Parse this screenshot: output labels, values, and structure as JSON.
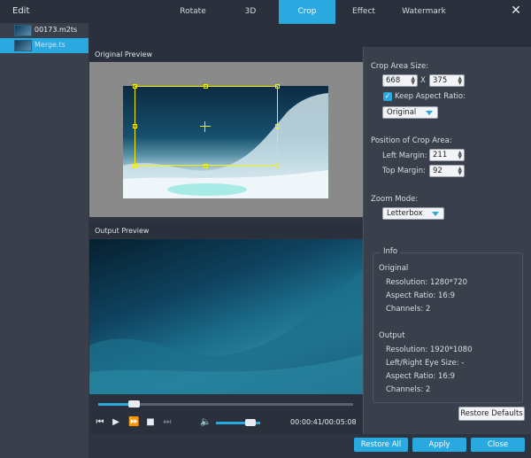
{
  "window": {
    "title": "Edit",
    "close_icon": "close-icon"
  },
  "files": [
    {
      "name": "00173.m2ts",
      "selected": false
    },
    {
      "name": "Merge.ts",
      "selected": true
    }
  ],
  "tabs": [
    {
      "label": "Rotate",
      "active": false
    },
    {
      "label": "3D",
      "active": false
    },
    {
      "label": "Crop",
      "active": true
    },
    {
      "label": "Effect",
      "active": false
    },
    {
      "label": "Watermark",
      "active": false
    }
  ],
  "preview": {
    "original_label": "Original Preview",
    "output_label": "Output Preview"
  },
  "player": {
    "time": "00:00:41/00:05:08",
    "progress_fraction": 0.14,
    "volume_fraction": 0.78,
    "icons": [
      "skip-back-icon",
      "play-icon",
      "fast-forward-icon",
      "stop-icon",
      "skip-forward-icon",
      "volume-icon"
    ]
  },
  "crop": {
    "area_size_label": "Crop Area Size:",
    "width": "668",
    "times": "X",
    "height": "375",
    "keep_aspect_label": "Keep Aspect Ratio:",
    "keep_aspect_checked": true,
    "aspect_value": "Original",
    "position_label": "Position of Crop Area:",
    "left_margin_label": "Left Margin:",
    "left_margin": "211",
    "top_margin_label": "Top Margin:",
    "top_margin": "92",
    "zoom_label": "Zoom Mode:",
    "zoom_value": "Letterbox"
  },
  "info": {
    "title": "Info",
    "original_label": "Original",
    "original_resolution": "Resolution: 1280*720",
    "original_aspect": "Aspect Ratio: 16:9",
    "original_channels": "Channels: 2",
    "output_label": "Output",
    "output_resolution": "Resolution: 1920*1080",
    "output_eye": "Left/Right Eye Size: -",
    "output_aspect": "Aspect Ratio: 16:9",
    "output_channels": "Channels: 2"
  },
  "buttons": {
    "restore_defaults": "Restore Defaults",
    "restore_all": "Restore All",
    "apply": "Apply",
    "close": "Close"
  },
  "colors": {
    "accent": "#2aa8e0",
    "crop_frame": "#f0f000"
  }
}
